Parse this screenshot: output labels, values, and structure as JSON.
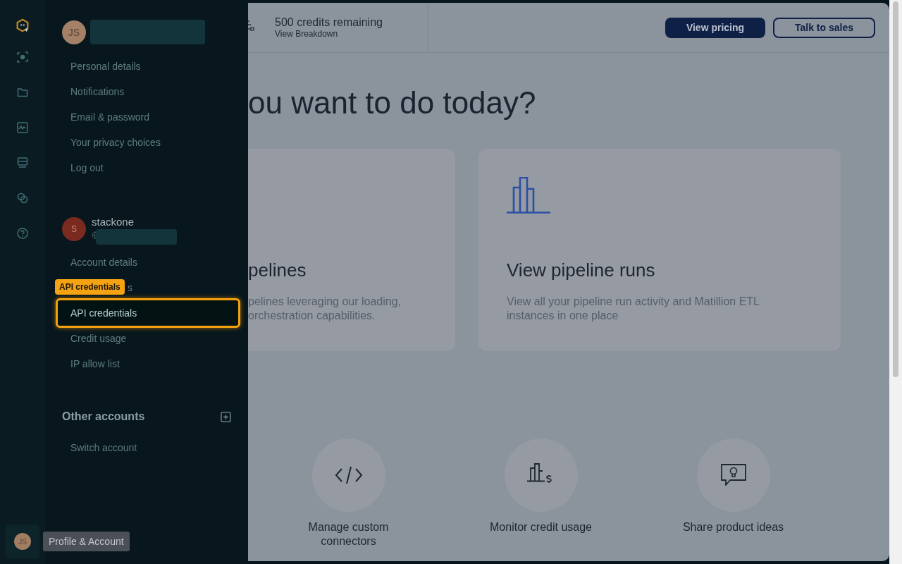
{
  "rail": {
    "avatar": "JS",
    "tooltip": "Profile & Account"
  },
  "profile": {
    "initials": "JS",
    "items": [
      {
        "label": "Personal details",
        "selected": false
      },
      {
        "label": "Notifications",
        "selected": false
      },
      {
        "label": "Email & password",
        "selected": false
      },
      {
        "label": "Your privacy choices",
        "selected": false
      },
      {
        "label": "Log out",
        "selected": false
      }
    ]
  },
  "organization": {
    "initial": "S",
    "name": "stackone",
    "items": [
      {
        "label": "Account details",
        "selected": false,
        "kind": "full"
      },
      {
        "label": "s",
        "selected": false,
        "kind": "partial",
        "tooltip": "API credentials"
      },
      {
        "label": "API credentials",
        "selected": true,
        "kind": "full"
      },
      {
        "label": "Credit usage",
        "selected": false,
        "kind": "full"
      },
      {
        "label": "IP allow list",
        "selected": false,
        "kind": "full"
      }
    ]
  },
  "other_accounts": {
    "title": "Other accounts",
    "items": [
      {
        "label": "Switch account",
        "selected": false
      }
    ]
  },
  "main": {
    "credits": {
      "title": "500 credits remaining",
      "link": "View Breakdown"
    },
    "buttons": [
      {
        "label": "View pricing",
        "kind": "primary"
      },
      {
        "label": "Talk to sales",
        "kind": "outline"
      }
    ],
    "heading": "ou want to do today?",
    "cards": [
      {
        "kind": "cut",
        "title": "pelines",
        "description": [
          "pelines leveraging our loading,",
          "orchestration capabilities."
        ]
      },
      {
        "kind": "chart",
        "title": "View pipeline runs",
        "description": [
          "View all your pipeline run activity and Matillion ETL",
          "instances in one place"
        ]
      }
    ],
    "shortcuts": [
      {
        "kind": "code",
        "label": "Manage custom connectors"
      },
      {
        "kind": "credit",
        "label": "Monitor credit usage"
      },
      {
        "kind": "idea",
        "label": "Share product ideas"
      }
    ]
  }
}
